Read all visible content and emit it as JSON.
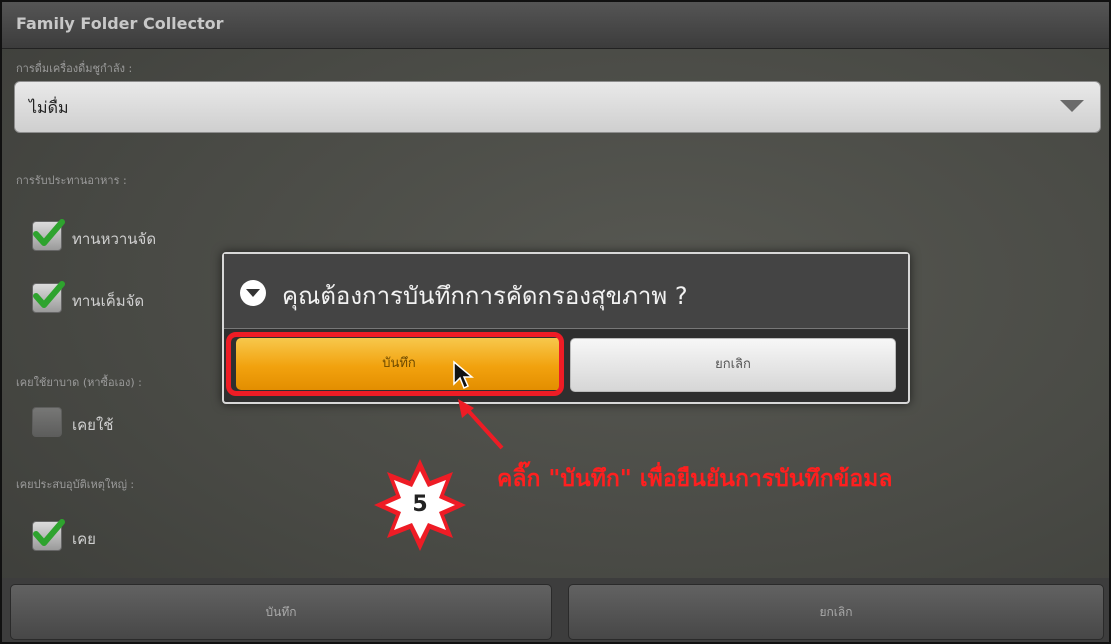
{
  "app": {
    "title": "Family Folder Collector"
  },
  "form": {
    "alcohol_label": "การดื่มเครื่องดื่มชูกำลัง :",
    "alcohol_value": "ไม่ดื่ม",
    "food_label": "การรับประทานอาหาร :",
    "food_options": [
      {
        "label": "ทานหวานจัด",
        "checked": true
      },
      {
        "label": "ทานเค็มจัด",
        "checked": true
      }
    ],
    "drug_label": "เคยใช้ยาบาด (หาซื้อเอง) :",
    "drug_option": {
      "label": "เคยใช้",
      "checked": false
    },
    "accident_label": "เคยประสบอุบัติเหตุใหญ่ :",
    "accident_option": {
      "label": "เคย",
      "checked": true
    }
  },
  "bottom": {
    "save_label": "บันทึก",
    "cancel_label": "ยกเลิก"
  },
  "dialog": {
    "title": "คุณต้องการบันทึกการคัดกรองสุขภาพ ?",
    "save_label": "บันทึก",
    "cancel_label": "ยกเลิก"
  },
  "annotation": {
    "step_number": "5",
    "note": "คลิ๊ก \"บันทึก\" เพื่อยืนยันการบันทึกข้อมล",
    "highlight_color": "#ee1c25"
  },
  "colors": {
    "accent": "#f2a20e",
    "annotation_red": "#ff1f1f"
  }
}
